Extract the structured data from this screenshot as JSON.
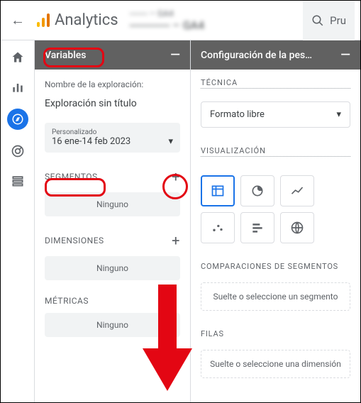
{
  "header": {
    "product": "Analytics",
    "breadcrumb_line1": "─── – GA4",
    "breadcrumb_line2": "───── – GA4",
    "search_label": "Pru"
  },
  "leftnav": {
    "items": [
      "home",
      "reports",
      "explore",
      "advertising",
      "configure"
    ]
  },
  "variables_panel": {
    "title": "Variables",
    "exploration_name_label": "Nombre de la exploración:",
    "exploration_name": "Exploración sin título",
    "date": {
      "label": "Personalizado",
      "value": "16 ene-14 feb 2023"
    },
    "segments": {
      "title": "SEGMENTOS",
      "empty": "Ninguno"
    },
    "dimensions": {
      "title": "DIMENSIONES",
      "empty": "Ninguno"
    },
    "metrics": {
      "title": "MÉTRICAS",
      "empty": "Ninguno"
    }
  },
  "settings_panel": {
    "title": "Configuración de la pes…",
    "technique_label": "TÉCNICA",
    "technique_value": "Formato libre",
    "viz_label": "VISUALIZACIÓN",
    "seg_compare_label": "COMPARACIONES DE SEGMENTOS",
    "seg_drop": "Suelte o seleccione un segmento",
    "rows_label": "FILAS",
    "rows_drop": "Suelte o seleccione una dimensión"
  }
}
